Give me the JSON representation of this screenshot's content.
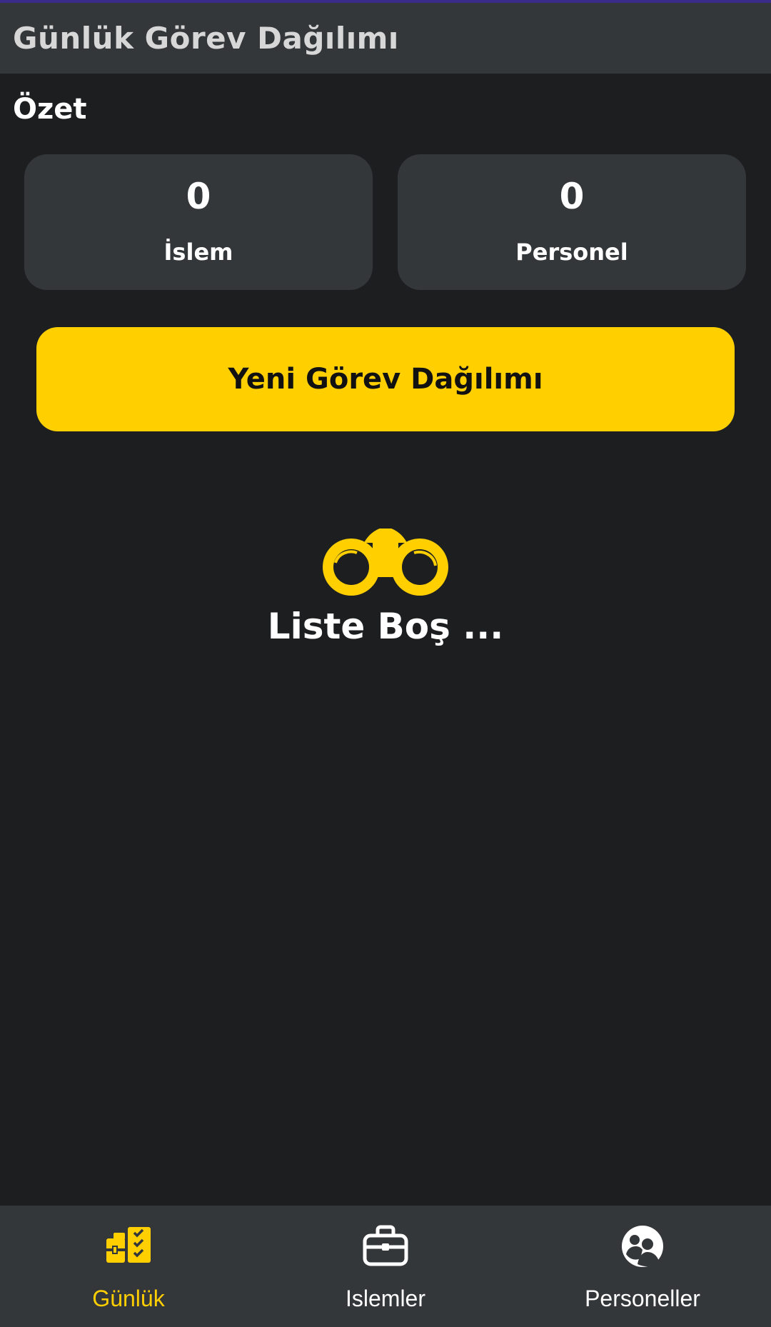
{
  "app_bar": {
    "title": "Günlük Görev Dağılımı"
  },
  "summary": {
    "heading": "Özet",
    "cards": [
      {
        "value": "0",
        "label": "İslem"
      },
      {
        "value": "0",
        "label": "Personel"
      }
    ]
  },
  "actions": {
    "new_assignment_label": "Yeni Görev Dağılımı"
  },
  "empty_state": {
    "icon": "binoculars-icon",
    "text": "Liste Boş ..."
  },
  "bottom_nav": {
    "items": [
      {
        "label": "Günlük",
        "icon": "daily-tasks-icon",
        "active": true
      },
      {
        "label": "Islemler",
        "icon": "briefcase-icon",
        "active": false
      },
      {
        "label": "Personeller",
        "icon": "people-icon",
        "active": false
      }
    ]
  },
  "colors": {
    "accent": "#ffcf00",
    "background": "#1c1e20",
    "surface": "#34373a",
    "status_bar": "#3a2a8a"
  }
}
